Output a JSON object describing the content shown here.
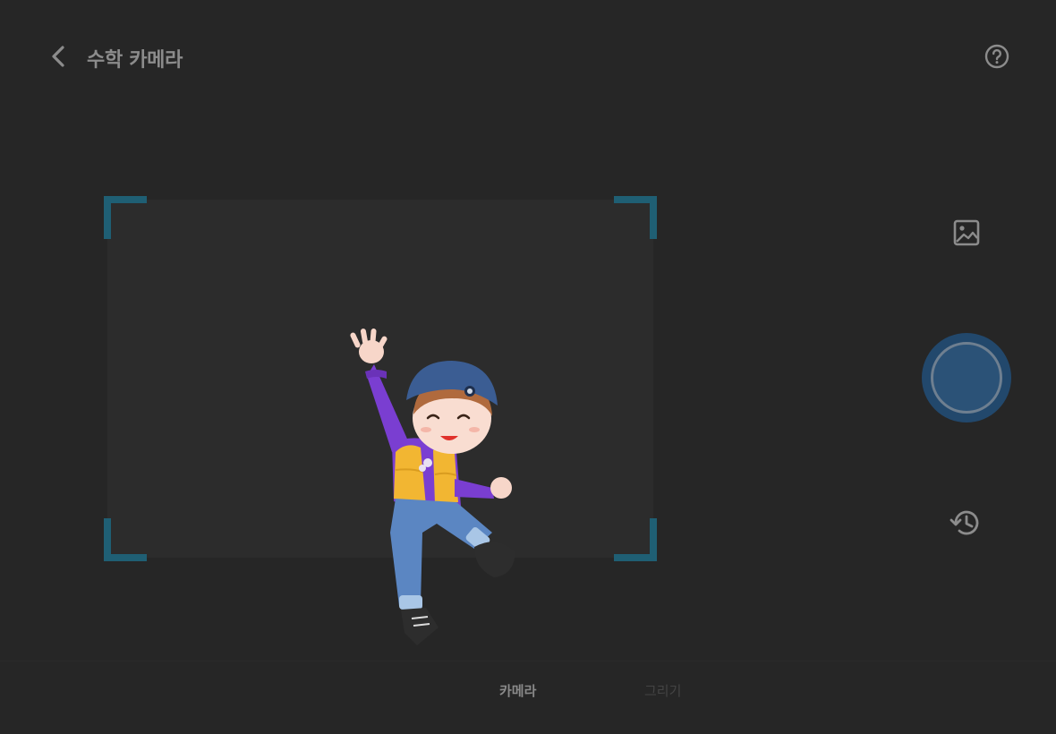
{
  "header": {
    "title": "수학 카메라",
    "back_icon": "chevron-left-icon",
    "help_icon": "question-circle-icon"
  },
  "viewfinder": {
    "corner_color": "#1f5f74"
  },
  "side_controls": {
    "gallery_icon": "image-icon",
    "shutter_color": "#22486c",
    "history_icon": "history-icon"
  },
  "tabs": [
    {
      "label": "카메라",
      "selected": true
    },
    {
      "label": "그리기",
      "selected": false
    }
  ]
}
